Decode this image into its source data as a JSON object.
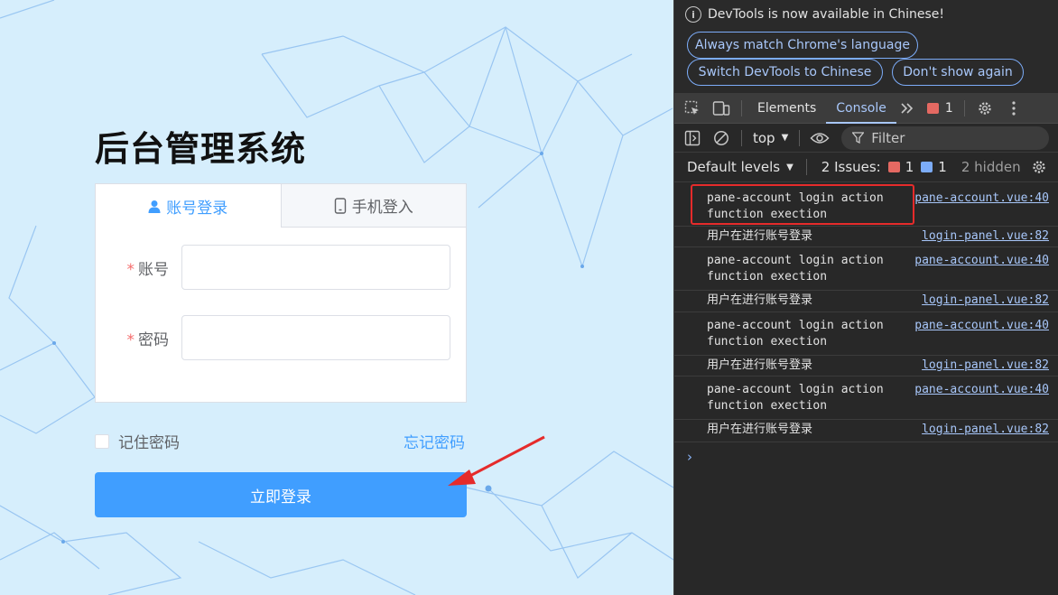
{
  "login": {
    "title": "后台管理系统",
    "tabs": [
      {
        "label": "账号登录",
        "icon": "user-icon",
        "active": true
      },
      {
        "label": "手机登入",
        "icon": "phone-icon",
        "active": false
      }
    ],
    "fields": [
      {
        "label": "账号",
        "required_mark": "*",
        "value": "",
        "placeholder": ""
      },
      {
        "label": "密码",
        "required_mark": "*",
        "value": "",
        "placeholder": ""
      }
    ],
    "remember_label": "记住密码",
    "forgot_label": "忘记密码",
    "submit_label": "立即登录",
    "accent_color": "#409eff"
  },
  "devtools": {
    "info_text": "DevTools is now available in Chinese!",
    "buttons": [
      "Always match Chrome's language",
      "Switch DevTools to Chinese",
      "Don't show again"
    ],
    "tabs": [
      "Elements",
      "Console"
    ],
    "active_tab": "Console",
    "error_count": "1",
    "context": "top",
    "filter_label": "Filter",
    "levels_label": "Default levels",
    "issues_label": "2 Issues:",
    "issues_error_count": "1",
    "issues_info_count": "1",
    "hidden_label": "2 hidden",
    "logs": [
      {
        "line1": "pane-account login action",
        "line2": "function exection",
        "source": "pane-account.vue:40"
      },
      {
        "line1": "用户在进行账号登录",
        "line2": "",
        "source": "login-panel.vue:82"
      },
      {
        "line1": "pane-account login action",
        "line2": "function exection",
        "source": "pane-account.vue:40"
      },
      {
        "line1": "用户在进行账号登录",
        "line2": "",
        "source": "login-panel.vue:82"
      },
      {
        "line1": "pane-account login action",
        "line2": "function exection",
        "source": "pane-account.vue:40"
      },
      {
        "line1": "用户在进行账号登录",
        "line2": "",
        "source": "login-panel.vue:82"
      },
      {
        "line1": "pane-account login action",
        "line2": "function exection",
        "source": "pane-account.vue:40"
      },
      {
        "line1": "用户在进行账号登录",
        "line2": "",
        "source": "login-panel.vue:82"
      }
    ],
    "prompt_symbol": "›"
  }
}
